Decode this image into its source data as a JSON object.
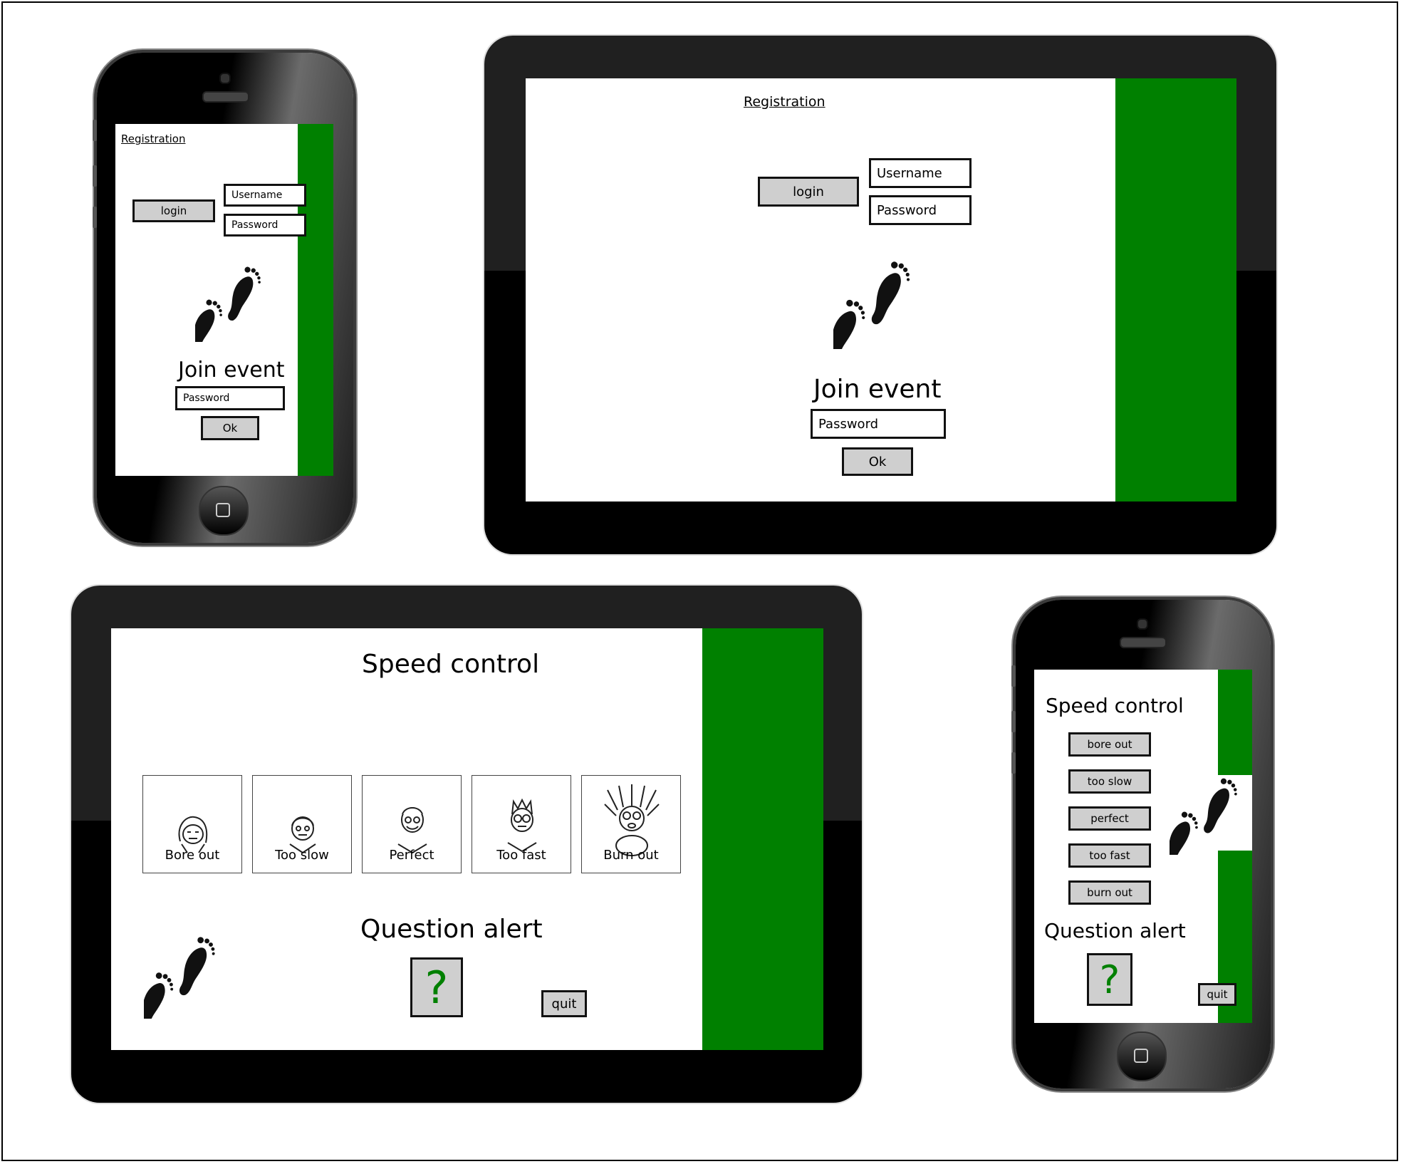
{
  "colors": {
    "accent": "#008000",
    "button_fill": "#cfcfcf",
    "bezel": "#000000"
  },
  "phone_login": {
    "registration_link": "Registration",
    "login_button": "login",
    "username_placeholder": "Username",
    "password_placeholder": "Password",
    "join_title": "Join event",
    "join_password_placeholder": "Password",
    "ok_button": "Ok",
    "icon": "footprints-icon"
  },
  "tablet_login": {
    "registration_link": "Registration",
    "login_button": "login",
    "username_placeholder": "Username",
    "password_placeholder": "Password",
    "join_title": "Join event",
    "join_password_placeholder": "Password",
    "ok_button": "Ok",
    "icon": "footprints-icon"
  },
  "tablet_speed": {
    "title": "Speed control",
    "options": [
      {
        "label": "Bore out",
        "icon": "bored-face-icon"
      },
      {
        "label": "Too slow",
        "icon": "slow-face-icon"
      },
      {
        "label": "Perfect",
        "icon": "happy-face-icon"
      },
      {
        "label": "Too fast",
        "icon": "fast-face-icon"
      },
      {
        "label": "Burn out",
        "icon": "burned-out-face-icon"
      }
    ],
    "question_title": "Question alert",
    "question_symbol": "?",
    "quit_button": "quit",
    "icon": "footprints-icon"
  },
  "phone_speed": {
    "title": "Speed control",
    "options": [
      "bore out",
      "too slow",
      "perfect",
      "too fast",
      "burn out"
    ],
    "question_title": "Question alert",
    "question_symbol": "?",
    "quit_button": "quit",
    "icon": "footprints-icon"
  }
}
